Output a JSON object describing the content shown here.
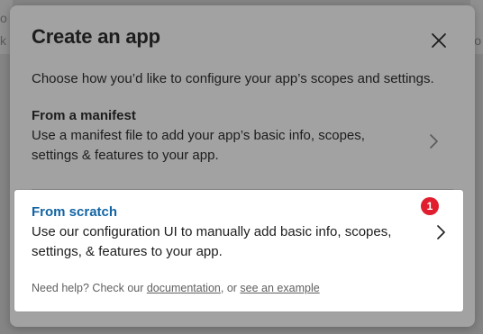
{
  "backdrop": {
    "letter_a": "o",
    "letter_b": "k",
    "letter_c": "o"
  },
  "modal": {
    "title": "Create an app",
    "close_icon": "close-icon",
    "intro": "Choose how you’d like to configure your app’s scopes and settings.",
    "options": {
      "manifest": {
        "title": "From a manifest",
        "description": "Use a manifest file to add your app’s basic info, scopes, settings & features to your app.",
        "icon": "chevron-right-icon"
      },
      "scratch": {
        "title": "From scratch",
        "description": "Use our configuration UI to manually add basic info, scopes, settings, & features to your app.",
        "icon": "chevron-right-icon",
        "badge": "1"
      }
    },
    "help": {
      "prefix": "Need help? Check our ",
      "documentation_link": "documentation",
      "middle": ", or ",
      "example_link": "see an example"
    }
  },
  "colors": {
    "link_blue": "#1264a3",
    "badge_red": "#e01e2f",
    "overlay": "#858585"
  }
}
